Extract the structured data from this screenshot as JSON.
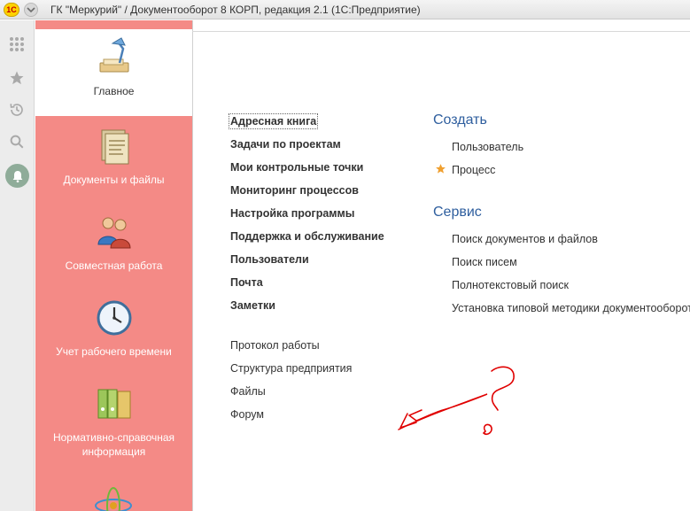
{
  "window": {
    "title": "ГК \"Меркурий\" / Документооборот 8 КОРП, редакция 2.1  (1С:Предприятие)",
    "logo_text": "1С"
  },
  "toolbar": {
    "icons": [
      "apps-grid-icon",
      "star-icon",
      "history-icon",
      "search-icon",
      "bell-icon"
    ]
  },
  "sections": [
    {
      "label": "Главное",
      "icon": "desk-lamp-icon"
    },
    {
      "label": "Документы и файлы",
      "icon": "documents-icon"
    },
    {
      "label": "Совместная работа",
      "icon": "users-icon"
    },
    {
      "label": "Учет рабочего времени",
      "icon": "clock-icon"
    },
    {
      "label": "Нормативно-справочная информация",
      "icon": "binders-icon"
    }
  ],
  "main": {
    "bold_links": [
      "Адресная книга",
      "Задачи по проектам",
      "Мои контрольные точки",
      "Мониторинг процессов",
      "Настройка программы",
      "Поддержка и обслуживание",
      "Пользователи",
      "Почта",
      "Заметки"
    ],
    "plain_links": [
      "Протокол работы",
      "Структура предприятия",
      "Файлы",
      "Форум"
    ],
    "create": {
      "title": "Создать",
      "items": [
        "Пользователь",
        "Процесс"
      ]
    },
    "service": {
      "title": "Сервис",
      "items": [
        "Поиск документов и файлов",
        "Поиск писем",
        "Полнотекстовый поиск",
        "Установка типовой методики документооборота"
      ]
    }
  },
  "colors": {
    "sections_bg": "#f48a86",
    "group_title": "#2e5e9e",
    "star": "#f0a030",
    "annotation": "#e00000"
  }
}
